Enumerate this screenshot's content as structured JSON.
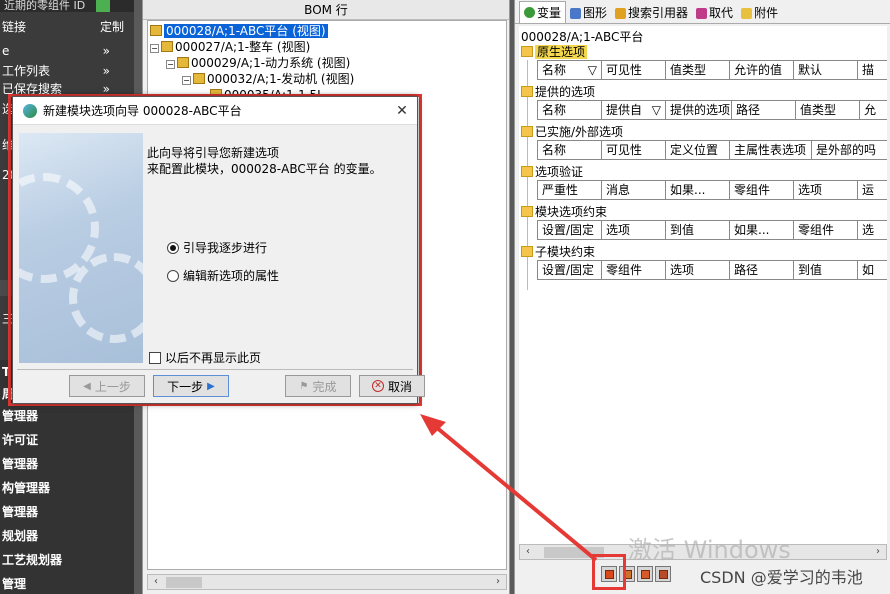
{
  "sidebar": {
    "top_label": "近期的零组件 ID",
    "rows": [
      {
        "label": "链接",
        "extra": "定制"
      },
      {
        "label": "e",
        "chev": "»"
      },
      {
        "label": "工作列表",
        "chev": "»"
      },
      {
        "label": "已保存搜索",
        "chev": "»"
      },
      {
        "label": "选"
      }
    ],
    "mid_rows": [
      "维",
      "28"
    ],
    "mid_rows2": [
      "三"
    ],
    "items": [
      "T",
      "周",
      "管理器",
      "许可证",
      "管理器",
      "构管理器",
      "管理器",
      "规划器",
      "工艺规划器",
      "管理"
    ]
  },
  "bom": {
    "header": "BOM 行",
    "rows": [
      {
        "text": "000028/A;1-ABC平台 (视图)",
        "selected": true
      },
      {
        "text": "000027/A;1-整车 (视图)"
      },
      {
        "text": "000029/A;1-动力系统 (视图)"
      },
      {
        "text": "000032/A;1-发动机 (视图)"
      },
      {
        "text": "000035/A;1-1.5L"
      }
    ]
  },
  "right": {
    "tabs": [
      {
        "label": "变量",
        "active": true,
        "icon": "variable-icon"
      },
      {
        "label": "图形",
        "icon": "graphics-icon"
      },
      {
        "label": "搜索引用器",
        "icon": "search-ref-icon"
      },
      {
        "label": "取代",
        "icon": "replace-icon"
      },
      {
        "label": "附件",
        "icon": "attachment-icon"
      }
    ],
    "title": "000028/A;1-ABC平台",
    "sections": [
      {
        "label": "原生选项",
        "cols": [
          "名称",
          "可见性",
          "值类型",
          "允许的值",
          "默认",
          "描"
        ]
      },
      {
        "label": "提供的选项",
        "cols": [
          "名称",
          "提供自",
          "提供的选项",
          "路径",
          "值类型",
          "允"
        ]
      },
      {
        "label": "已实施/外部选项",
        "cols": [
          "名称",
          "可见性",
          "定义位置",
          "主属性表选项",
          "是外部的吗"
        ]
      },
      {
        "label": "选项验证",
        "cols": [
          "严重性",
          "消息",
          "如果...",
          "零组件",
          "选项",
          "运"
        ]
      },
      {
        "label": "模块选项约束",
        "cols": [
          "设置/固定",
          "选项",
          "到值",
          "如果...",
          "零组件",
          "选"
        ]
      },
      {
        "label": "子模块约束",
        "cols": [
          "设置/固定",
          "零组件",
          "选项",
          "路径",
          "到值",
          "如"
        ]
      }
    ]
  },
  "watermark": {
    "line1": "激活 Windows",
    "line2": "CSDN @爱学习的韦池"
  },
  "dialog": {
    "title": "新建模块选项向导 000028-ABC平台",
    "intro_line1": "此向导将引导您新建选项",
    "intro_line2": "来配置此模块，000028-ABC平台 的变量。",
    "radio1": "引导我逐步进行",
    "radio2": "编辑新选项的属性",
    "checkbox": "以后不再显示此页",
    "btn_prev": "上一步",
    "btn_next": "下一步",
    "btn_finish": "完成",
    "btn_cancel": "取消"
  },
  "colors": {
    "selection": "#0a64d8",
    "highlight": "#e53935",
    "section_highlight": "#f2d64d"
  }
}
